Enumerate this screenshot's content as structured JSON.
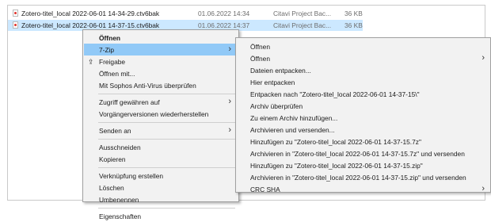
{
  "files": [
    {
      "name": "Zotero-titel_local 2022-06-01 14-34-29.ctv6bak",
      "date": "01.06.2022 14:34",
      "type": "Citavi Project Bac...",
      "size": "36 KB"
    },
    {
      "name": "Zotero-titel_local 2022-06-01 14-37-15.ctv6bak",
      "date": "01.06.2022 14:37",
      "type": "Citavi Project Bac...",
      "size": "36 KB"
    }
  ],
  "context_menu": {
    "items": [
      {
        "label": "Öffnen"
      },
      {
        "label": "7-Zip"
      },
      {
        "label": "Freigabe"
      },
      {
        "label": "Öffnen mit..."
      },
      {
        "label": "Mit Sophos Anti-Virus überprüfen"
      },
      {
        "label": "Zugriff gewähren auf"
      },
      {
        "label": "Vorgängerversionen wiederherstellen"
      },
      {
        "label": "Senden an"
      },
      {
        "label": "Ausschneiden"
      },
      {
        "label": "Kopieren"
      },
      {
        "label": "Verknüpfung erstellen"
      },
      {
        "label": "Löschen"
      },
      {
        "label": "Umbenennen"
      },
      {
        "label": "Eigenschaften"
      }
    ]
  },
  "submenu_7zip": {
    "items": [
      {
        "label": "Öffnen"
      },
      {
        "label": "Öffnen"
      },
      {
        "label": "Dateien entpacken..."
      },
      {
        "label": "Hier entpacken"
      },
      {
        "label": "Entpacken nach \"Zotero-titel_local 2022-06-01 14-37-15\\\""
      },
      {
        "label": "Archiv überprüfen"
      },
      {
        "label": "Zu einem Archiv hinzufügen..."
      },
      {
        "label": "Archivieren und versenden..."
      },
      {
        "label": "Hinzufügen zu \"Zotero-titel_local 2022-06-01 14-37-15.7z\""
      },
      {
        "label": "Archivieren in \"Zotero-titel_local 2022-06-01 14-37-15.7z\" und versenden"
      },
      {
        "label": "Hinzufügen zu \"Zotero-titel_local 2022-06-01 14-37-15.zip\""
      },
      {
        "label": "Archivieren in \"Zotero-titel_local 2022-06-01 14-37-15.zip\" und versenden"
      },
      {
        "label": "CRC SHA"
      }
    ]
  },
  "icons": {
    "submenu_arrow": "chevron-right-icon",
    "share": "share-icon",
    "file": "file-icon"
  },
  "colors": {
    "selection": "#cce8ff",
    "highlight": "#91c9f7",
    "menu_bg": "#f2f2f2"
  }
}
